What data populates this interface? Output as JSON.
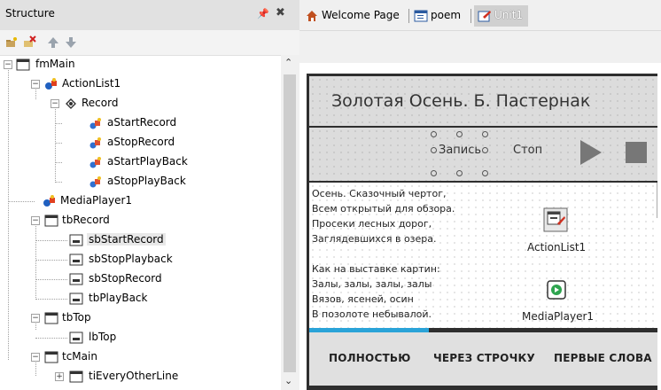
{
  "structure": {
    "title": "Structure",
    "tree": [
      {
        "label": "fmMain"
      },
      {
        "label": "ActionList1"
      },
      {
        "label": "Record"
      },
      {
        "label": "aStartRecord"
      },
      {
        "label": "aStopRecord"
      },
      {
        "label": "aStartPlayBack"
      },
      {
        "label": "aStopPlayBack"
      },
      {
        "label": "MediaPlayer1"
      },
      {
        "label": "tbRecord"
      },
      {
        "label": "sbStartRecord"
      },
      {
        "label": "sbStopPlayback"
      },
      {
        "label": "sbStopRecord"
      },
      {
        "label": "tbPlayBack"
      },
      {
        "label": "tbTop"
      },
      {
        "label": "lbTop"
      },
      {
        "label": "tcMain"
      },
      {
        "label": "tiEveryOtherLine"
      }
    ],
    "selected_item": "sbStartRecord"
  },
  "tabs": [
    {
      "label": "Welcome Page"
    },
    {
      "label": "poem"
    },
    {
      "label": "Unit1"
    }
  ],
  "form": {
    "title": "Золотая Осень. Б. Пастернак",
    "record_button": "Запись",
    "stop_button": "Стоп",
    "memo_lines": [
      "Осень. Сказочный чертог,",
      "Всем открытый для обзора.",
      "Просеки лесных дорог,",
      "Заглядевшихся в озера.",
      "",
      "Как на выставке картин:",
      "Залы, залы, залы, залы",
      "Вязов, ясеней, осин",
      "В позолоте небывалой."
    ],
    "components": {
      "action_list": "ActionList1",
      "media_player": "MediaPlayer1"
    },
    "bottom_tabs": [
      "ПОЛНОСТЬЮ",
      "ЧЕРЕЗ СТРОЧКУ",
      "ПЕРВЫЕ СЛОВА"
    ],
    "accent_color": "#2aa3d8"
  }
}
